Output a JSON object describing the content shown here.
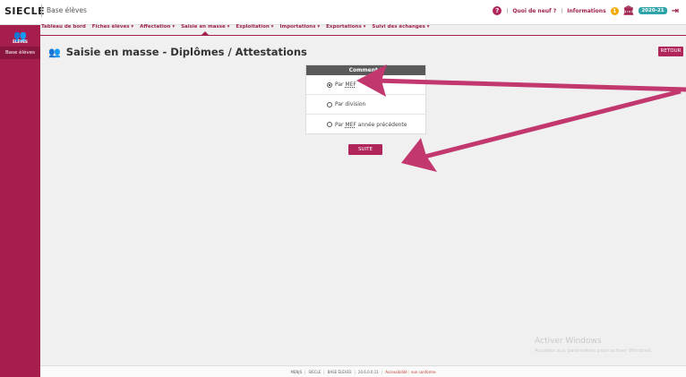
{
  "header": {
    "brand": "SIECLE",
    "app_name": "Base élèves",
    "whats_new": "Quoi de neuf ?",
    "informations": "Informations",
    "info_count": "1",
    "school_year": "2020-21",
    "separator": "|"
  },
  "menu": [
    {
      "label": "Tableau de bord"
    },
    {
      "label": "Fiches élèves ▾"
    },
    {
      "label": "Affectation ▾"
    },
    {
      "label": "Saisie en masse ▾"
    },
    {
      "label": "Exploitation ▾"
    },
    {
      "label": "Importations ▾"
    },
    {
      "label": "Exportations ▾"
    },
    {
      "label": "Suivi des échanges ▾"
    }
  ],
  "sidebar": {
    "logo_caption": "ÉLÈVES",
    "active_label": "Base élèves"
  },
  "page": {
    "title": "Saisie en masse - Diplômes / Attestations",
    "retour_label": "RETOUR"
  },
  "panel": {
    "header": "Comment ?",
    "options": [
      {
        "prefix": "Par ",
        "abbr": "MEF",
        "suffix": "",
        "checked": true
      },
      {
        "prefix": "Par division",
        "abbr": "",
        "suffix": "",
        "checked": false
      },
      {
        "prefix": "Par ",
        "abbr": "MEF",
        "suffix": " année précédente",
        "checked": false
      }
    ],
    "suite_label": "SUITE"
  },
  "watermark": {
    "title": "Activer Windows",
    "subtitle": "Accédez aux paramètres pour activer Windows."
  },
  "footer": {
    "items": [
      "MENJS",
      "SIECLE",
      "BASE ÉLÈVES",
      "20.6.0.0.11",
      "Accessibilité : non conforme"
    ],
    "separator": "|"
  },
  "colors": {
    "accent": "#a61e4d",
    "button": "#b0255a",
    "badge_teal": "#2fa4a8",
    "badge_yellow": "#f2a900",
    "panel_header": "#5a5a5a",
    "arrow": "#c2386e"
  },
  "icons": [
    "help-icon",
    "bank-icon",
    "logout-icon",
    "students-icon"
  ]
}
